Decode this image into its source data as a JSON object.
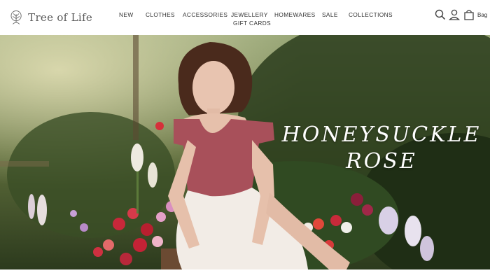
{
  "brand": {
    "name": "Tree of Life",
    "logo_icon": "tree-icon"
  },
  "nav": {
    "items": [
      {
        "label": "NEW"
      },
      {
        "label": "CLOTHES"
      },
      {
        "label": "ACCESSORIES"
      },
      {
        "label": "JEWELLERY"
      },
      {
        "label": "HOMEWARES"
      },
      {
        "label": "SALE"
      },
      {
        "label": "COLLECTIONS"
      },
      {
        "label": "GIFT CARDS"
      }
    ]
  },
  "header_icons": {
    "search": "search-icon",
    "account": "user-icon",
    "bag": "bag-icon",
    "bag_label": "Bag"
  },
  "hero": {
    "title_line1": "HONEYSUCKLE",
    "title_line2": "ROSE",
    "dress_color": "#a8505a",
    "skirt_color": "#f2ece6",
    "foliage_color": "#2f4420"
  }
}
